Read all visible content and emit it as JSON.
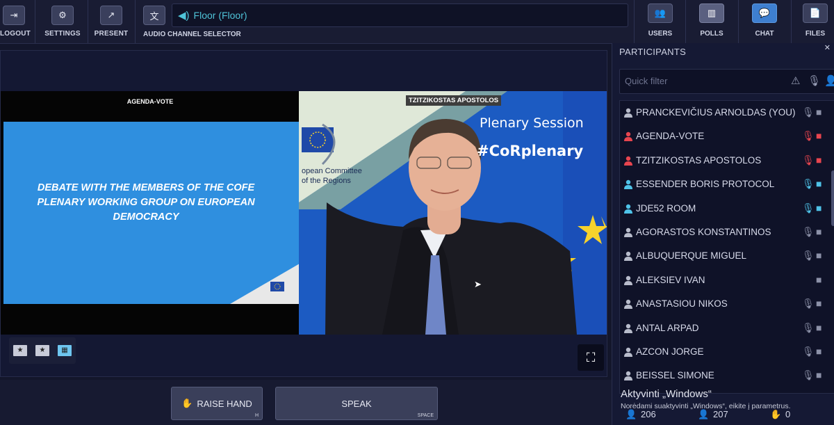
{
  "toolbar": {
    "logout": "LOGOUT",
    "settings": "SETTINGS",
    "present": "PRESENT",
    "audio_channel_selector": "AUDIO CHANNEL SELECTOR",
    "floor_value": "Floor (Floor)",
    "users": "USERS",
    "polls": "POLLS",
    "chat": "CHAT",
    "files": "FILES"
  },
  "stage": {
    "left_title": "AGENDA-VOTE",
    "slide_text": "DEBATE WITH THE MEMBERS OF THE COFE PLENARY WORKING GROUP ON EUROPEAN DEMOCRACY",
    "speaker_tag": "TZITZIKOSTAS APOSTOLOS",
    "backdrop_title": "Plenary Session",
    "backdrop_hashtag": "#CoRplenary",
    "backdrop_org": "opean Committee\nof the Regions"
  },
  "bottom": {
    "raise_hand": "RAISE HAND",
    "raise_hand_key": "H",
    "speak": "SPEAK",
    "speak_key": "SPACE"
  },
  "participants": {
    "header": "PARTICIPANTS",
    "filter_placeholder": "Quick filter",
    "list": [
      {
        "name": "PRANCKEVIČIUS ARNOLDAS (YOU)",
        "status": "muted",
        "person_color": "#b8bccb",
        "mic_color": "#8c91a8",
        "cam_color": "#8c91a8"
      },
      {
        "name": "AGENDA-VOTE",
        "status": "live",
        "person_color": "#e8454f",
        "mic_color": "#e8454f",
        "cam_color": "#e8454f"
      },
      {
        "name": "TZITZIKOSTAS APOSTOLOS",
        "status": "live",
        "person_color": "#e8454f",
        "mic_color": "#e8454f",
        "cam_color": "#e8454f"
      },
      {
        "name": "ESSENDER BORIS PROTOCOL",
        "status": "connected",
        "person_color": "#4fc3e8",
        "mic_color": "#4fc3e8",
        "cam_color": "#4fc3e8"
      },
      {
        "name": "JDE52 ROOM",
        "status": "connected",
        "person_color": "#4fc3e8",
        "mic_color": "#4fc3e8",
        "cam_color": "#4fc3e8"
      },
      {
        "name": "AGORASTOS KONSTANTINOS",
        "status": "muted",
        "person_color": "#b8bccb",
        "mic_color": "#8c91a8",
        "cam_color": "#8c91a8"
      },
      {
        "name": "ALBUQUERQUE MIGUEL",
        "status": "muted",
        "person_color": "#b8bccb",
        "mic_color": "#8c91a8",
        "cam_color": "#8c91a8"
      },
      {
        "name": "ALEKSIEV IVAN",
        "status": "muted",
        "person_color": "#b8bccb",
        "mic_color": "",
        "cam_color": "#8c91a8"
      },
      {
        "name": "ANASTASIOU NIKOS",
        "status": "muted",
        "person_color": "#b8bccb",
        "mic_color": "#8c91a8",
        "cam_color": "#8c91a8"
      },
      {
        "name": "ANTAL ARPAD",
        "status": "muted",
        "person_color": "#b8bccb",
        "mic_color": "#8c91a8",
        "cam_color": "#8c91a8"
      },
      {
        "name": "AZCON JORGE",
        "status": "muted",
        "person_color": "#b8bccb",
        "mic_color": "#8c91a8",
        "cam_color": "#8c91a8"
      },
      {
        "name": "BEISSEL SIMONE",
        "status": "muted",
        "person_color": "#b8bccb",
        "mic_color": "#8c91a8",
        "cam_color": "#8c91a8"
      }
    ],
    "count_users": "206",
    "count_b": "207",
    "count_hands": "0"
  },
  "os_overlay": {
    "line1": "Aktyvinti „Windows“",
    "line2": "Norėdami suaktyvinti „Windows“, eikite į parametrus."
  },
  "colors": {
    "accent": "#4fc3d8",
    "live": "#e8454f",
    "connected": "#4fc3e8",
    "slide_blue": "#2f8fdf"
  }
}
